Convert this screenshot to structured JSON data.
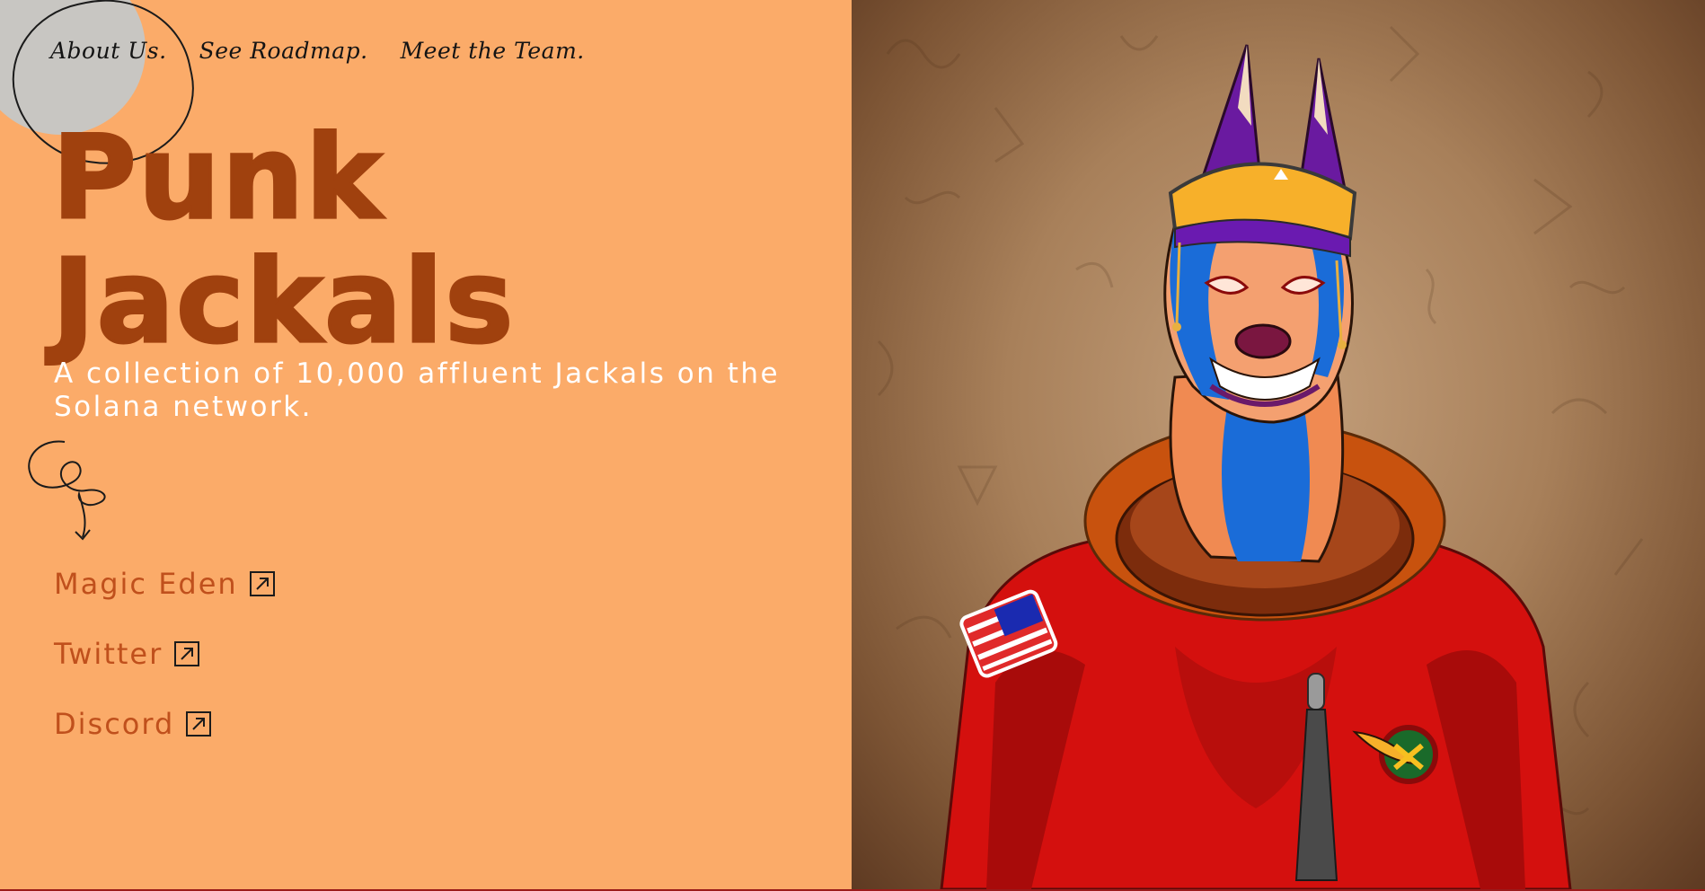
{
  "nav": {
    "items": [
      {
        "label": "About Us."
      },
      {
        "label": "See Roadmap."
      },
      {
        "label": "Meet the Team."
      }
    ]
  },
  "hero": {
    "title_line1": "Punk",
    "title_line2": "Jackals",
    "subtitle": "A collection of 10,000 affluent Jackals on the Solana network."
  },
  "links": [
    {
      "label": "Magic Eden",
      "icon": "external-link-icon"
    },
    {
      "label": "Twitter",
      "icon": "external-link-icon"
    },
    {
      "label": "Discord",
      "icon": "external-link-icon"
    }
  ],
  "colors": {
    "left_background": "#fbab69",
    "title": "#a0410e",
    "link": "#c0501c",
    "subtitle": "#ffffff"
  }
}
